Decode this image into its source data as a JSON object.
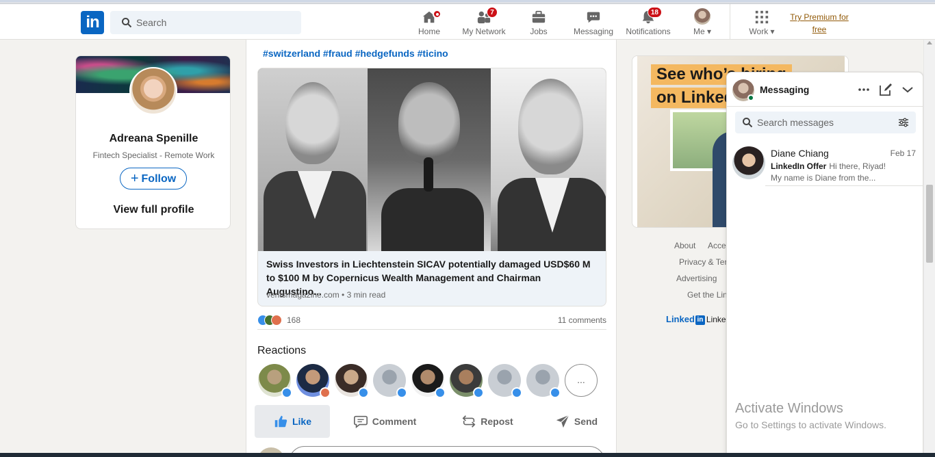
{
  "nav": {
    "logo_text": "in",
    "search_placeholder": "Search",
    "items": [
      {
        "label": "Home",
        "badge": ""
      },
      {
        "label": "My Network",
        "badge": "7"
      },
      {
        "label": "Jobs",
        "badge": ""
      },
      {
        "label": "Messaging",
        "badge": ""
      },
      {
        "label": "Notifications",
        "badge": "18"
      },
      {
        "label": "Me",
        "badge": ""
      },
      {
        "label": "Work",
        "badge": ""
      }
    ],
    "premium_line1": "Try Premium for",
    "premium_line2": "free"
  },
  "profile": {
    "name": "Adreana Spenille",
    "headline": "Fintech Specialist - Remote Work",
    "follow_label": "Follow",
    "view_profile_label": "View full profile"
  },
  "post": {
    "hashtags": "#switzerland #fraud #hedgefunds #ticino",
    "article_title": "Swiss Investors in Liechtenstein SICAV potentially damaged USD$60 M to $100 M by Copernicus Wealth Management and Chairman Augustino...",
    "article_meta": "ventsmagazine.com • 3 min read",
    "reaction_count": "168",
    "comments_count": "11 comments",
    "reactions_heading": "Reactions",
    "more_reactors": "...",
    "actions": {
      "like": "Like",
      "comment": "Comment",
      "repost": "Repost",
      "send": "Send"
    }
  },
  "ad": {
    "line1": "See who’s hiring",
    "line2": "on LinkedIn"
  },
  "footer": {
    "about": "About",
    "accessibility": "Acces",
    "privacy": "Privacy & Ter",
    "advertising": "Advertising",
    "get_app": "Get the Lin",
    "brand": "Linked",
    "brand_in": "in",
    "brand_corp": "Linke"
  },
  "messaging": {
    "title": "Messaging",
    "search_placeholder": "Search messages",
    "conversations": [
      {
        "name": "Diane Chiang",
        "date": "Feb 17",
        "tag": "LinkedIn Offer",
        "preview1": "Hi there, Riyad!",
        "preview2": "My name is Diane from the..."
      }
    ]
  },
  "watermark": {
    "line1": "Activate Windows",
    "line2": "Go to Settings to activate Windows."
  },
  "colors": {
    "brand": "#0a66c2",
    "badge": "#cc1016",
    "premium": "#915907"
  }
}
